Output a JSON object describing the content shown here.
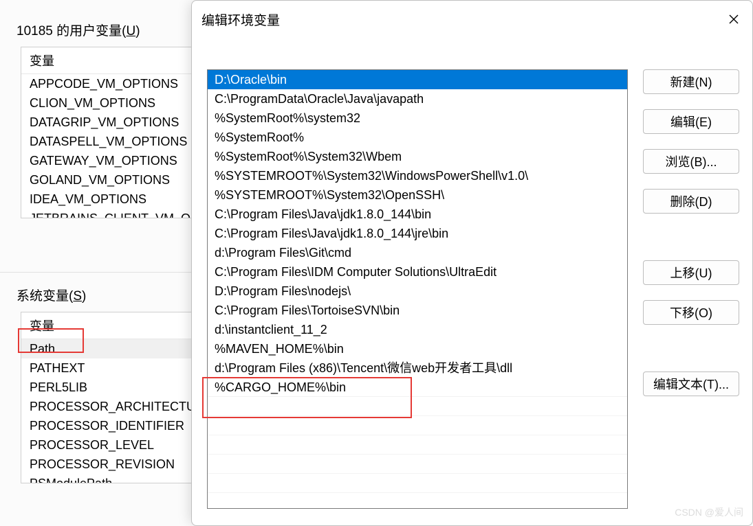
{
  "userVars": {
    "label_prefix": "10185 的用户变量(",
    "label_key": "U",
    "label_suffix": ")",
    "header": "变量",
    "items": [
      "APPCODE_VM_OPTIONS",
      "CLION_VM_OPTIONS",
      "DATAGRIP_VM_OPTIONS",
      "DATASPELL_VM_OPTIONS",
      "GATEWAY_VM_OPTIONS",
      "GOLAND_VM_OPTIONS",
      "IDEA_VM_OPTIONS",
      "JETBRAINS_CLIENT_VM_OPTIONS"
    ]
  },
  "sysVars": {
    "label_prefix": "系统变量(",
    "label_key": "S",
    "label_suffix": ")",
    "header": "变量",
    "items": [
      "Path",
      "PATHEXT",
      "PERL5LIB",
      "PROCESSOR_ARCHITECTURE",
      "PROCESSOR_IDENTIFIER",
      "PROCESSOR_LEVEL",
      "PROCESSOR_REVISION",
      "PSModulePath"
    ],
    "selectedIndex": 0
  },
  "dialog": {
    "title": "编辑环境变量",
    "paths": [
      "D:\\Oracle\\bin",
      "C:\\ProgramData\\Oracle\\Java\\javapath",
      "%SystemRoot%\\system32",
      "%SystemRoot%",
      "%SystemRoot%\\System32\\Wbem",
      "%SYSTEMROOT%\\System32\\WindowsPowerShell\\v1.0\\",
      "%SYSTEMROOT%\\System32\\OpenSSH\\",
      "C:\\Program Files\\Java\\jdk1.8.0_144\\bin",
      "C:\\Program Files\\Java\\jdk1.8.0_144\\jre\\bin",
      "d:\\Program Files\\Git\\cmd",
      "C:\\Program Files\\IDM Computer Solutions\\UltraEdit",
      "D:\\Program Files\\nodejs\\",
      "C:\\Program Files\\TortoiseSVN\\bin",
      "d:\\instantclient_11_2",
      "%MAVEN_HOME%\\bin",
      "d:\\Program Files (x86)\\Tencent\\微信web开发者工具\\dll",
      "%CARGO_HOME%\\bin"
    ],
    "selectedIndex": 0,
    "buttons": {
      "new": "新建(N)",
      "edit": "编辑(E)",
      "browse": "浏览(B)...",
      "delete": "删除(D)",
      "moveUp": "上移(U)",
      "moveDown": "下移(O)",
      "editText": "编辑文本(T)..."
    }
  },
  "watermark": "CSDN @爱人间"
}
